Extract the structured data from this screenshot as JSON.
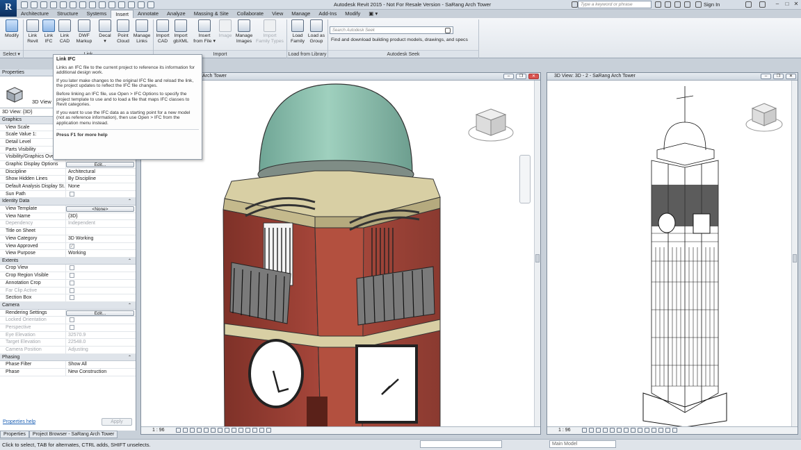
{
  "app": {
    "logo": "R",
    "title": "Autodesk Revit 2015 - Not For Resale Version -   SaRang Arch Tower",
    "search_placeholder": "Type a keyword or phrase",
    "sign_in": "Sign In"
  },
  "ribbon_tabs": [
    "Architecture",
    "Structure",
    "Systems",
    "Insert",
    "Annotate",
    "Analyze",
    "Massing & Site",
    "Collaborate",
    "View",
    "Manage",
    "Add-Ins",
    "Modify"
  ],
  "active_tab": "Insert",
  "ribbon": {
    "modify": "Modify",
    "select": "Select ▾",
    "link_revit": [
      "Link",
      "Revit"
    ],
    "link_ifc": [
      "Link",
      "IFC"
    ],
    "link_cad": [
      "Link",
      "CAD"
    ],
    "dwf_markup": [
      "DWF",
      "Markup"
    ],
    "decal": [
      "Decal",
      "▾"
    ],
    "point_cloud": [
      "Point",
      "Cloud"
    ],
    "manage_links": [
      "Manage",
      "Links"
    ],
    "import_cad": [
      "Import",
      "CAD"
    ],
    "import_gbxml": [
      "Import",
      "gbXML"
    ],
    "insert_from_file": [
      "Insert",
      "from File ▾"
    ],
    "image": [
      "Image",
      ""
    ],
    "manage_images": [
      "Manage",
      "Images"
    ],
    "import_family_types": [
      "Import",
      "Family Types"
    ],
    "load_family": [
      "Load",
      "Family"
    ],
    "load_as_group": [
      "Load as",
      "Group"
    ],
    "panel_link": "Link",
    "panel_import": "Import",
    "panel_load_library": "Load from Library",
    "panel_seek": "Autodesk Seek",
    "seek_placeholder": "Search Autodesk Seek",
    "seek_text": "Find and download building product models, drawings, and specs"
  },
  "tooltip": {
    "title": "Link IFC",
    "p1": "Links an IFC file to the current project to reference its information for additional design work.",
    "p2": "If you later make changes to the original IFC file and reload the link, the project updates to reflect the IFC file changes.",
    "p3": "Before linking an IFC file, use Open > IFC Options to specify the project template to use and to load a file that maps IFC classes to Revit categories.",
    "p4": "If you want to use the IFC data as a starting point for a new model (not as reference information), then use Open > IFC from the application menu instead.",
    "footer": "Press F1 for more help"
  },
  "properties": {
    "title": "Properties",
    "type_name": "3D View",
    "instance": "3D View: {3D}",
    "sections": [
      {
        "name": "Graphics",
        "rows": [
          {
            "k": "View Scale",
            "v": "",
            "kind": "text"
          },
          {
            "k": "Scale Value    1:",
            "v": "",
            "kind": "text"
          },
          {
            "k": "Detail Level",
            "v": "",
            "kind": "text"
          },
          {
            "k": "Parts Visibility",
            "v": "",
            "kind": "text"
          },
          {
            "k": "Visibility/Graphics Overrides",
            "v": "Edit...",
            "kind": "button"
          },
          {
            "k": "Graphic Display Options",
            "v": "Edit...",
            "kind": "button"
          },
          {
            "k": "Discipline",
            "v": "Architectural",
            "kind": "text"
          },
          {
            "k": "Show Hidden Lines",
            "v": "By Discipline",
            "kind": "text"
          },
          {
            "k": "Default Analysis Display St...",
            "v": "None",
            "kind": "text"
          },
          {
            "k": "Sun Path",
            "v": "",
            "kind": "check"
          }
        ]
      },
      {
        "name": "Identity Data",
        "rows": [
          {
            "k": "View Template",
            "v": "<None>",
            "kind": "button"
          },
          {
            "k": "View Name",
            "v": "{3D}",
            "kind": "text"
          },
          {
            "k": "Dependency",
            "v": "Independent",
            "kind": "dim"
          },
          {
            "k": "Title on Sheet",
            "v": "",
            "kind": "text"
          },
          {
            "k": "View Category",
            "v": "3D Working",
            "kind": "text"
          },
          {
            "k": "View Approved",
            "v": "",
            "kind": "checkon"
          },
          {
            "k": "View Purpose",
            "v": "Working",
            "kind": "text"
          }
        ]
      },
      {
        "name": "Extents",
        "rows": [
          {
            "k": "Crop View",
            "v": "",
            "kind": "check"
          },
          {
            "k": "Crop Region Visible",
            "v": "",
            "kind": "check"
          },
          {
            "k": "Annotation Crop",
            "v": "",
            "kind": "check"
          },
          {
            "k": "Far Clip Active",
            "v": "",
            "kind": "dimcheck"
          },
          {
            "k": "Section Box",
            "v": "",
            "kind": "check"
          }
        ]
      },
      {
        "name": "Camera",
        "rows": [
          {
            "k": "Rendering Settings",
            "v": "Edit...",
            "kind": "button"
          },
          {
            "k": "Locked Orientation",
            "v": "",
            "kind": "dimcheck"
          },
          {
            "k": "Perspective",
            "v": "",
            "kind": "dimcheck"
          },
          {
            "k": "Eye Elevation",
            "v": "32570.9",
            "kind": "dim"
          },
          {
            "k": "Target Elevation",
            "v": "22548.0",
            "kind": "dim"
          },
          {
            "k": "Camera Position",
            "v": "Adjusting",
            "kind": "dim"
          }
        ]
      },
      {
        "name": "Phasing",
        "rows": [
          {
            "k": "Phase Filter",
            "v": "Show All",
            "kind": "text"
          },
          {
            "k": "Phase",
            "v": "New Construction",
            "kind": "text"
          }
        ]
      }
    ],
    "help": "Properties help",
    "apply": "Apply"
  },
  "palette_tabs": [
    "Properties",
    "Project Browser - SaRang Arch Tower"
  ],
  "view_left": {
    "title": "Arch Tower",
    "scale": "1 : 96"
  },
  "view_right": {
    "title": "3D View: 3D - 2 - SaRang Arch Tower",
    "scale": "1 : 96"
  },
  "status": {
    "hint": "Click to select, TAB for alternates, CTRL adds, SHIFT unselects.",
    "main_model": "Main Model"
  },
  "colors": {
    "dome": "#8cbfae",
    "brick": "#a5473b",
    "stone": "#d9cfa6",
    "clock_face": "#ffffff"
  }
}
